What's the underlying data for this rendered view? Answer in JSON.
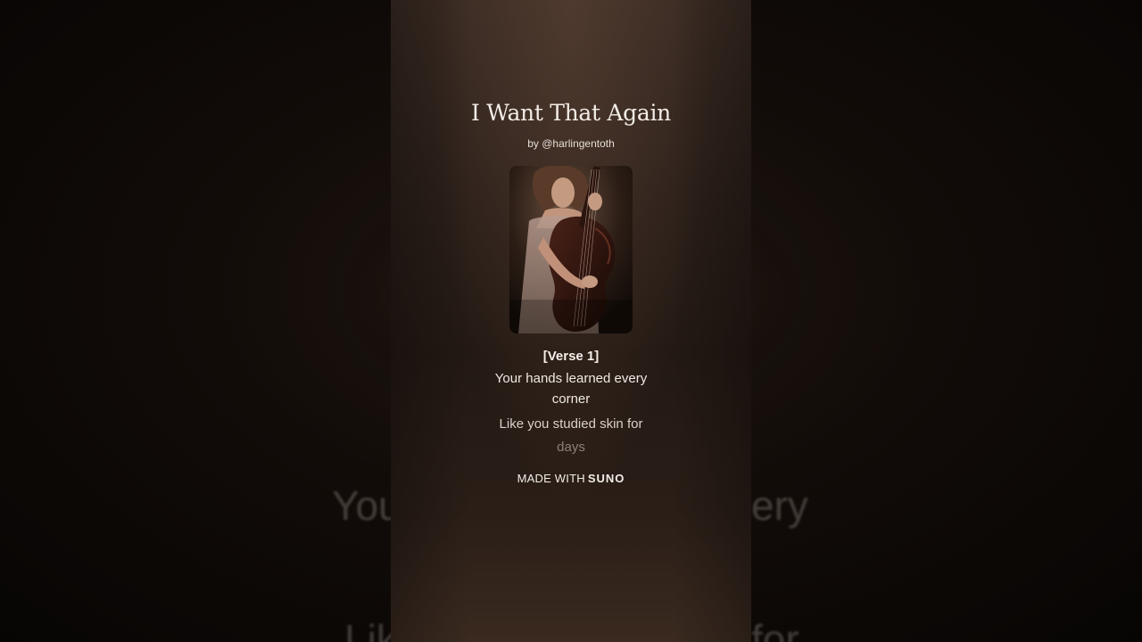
{
  "song": {
    "title": "I Want That Again",
    "artist": "by @harlingentoth"
  },
  "lyrics": {
    "section": "[Verse 1]",
    "line1": "Your hands learned every corner",
    "line2_part1": "Like you studied skin for",
    "line2_part2": "days"
  },
  "backdrop": {
    "left_1": "You",
    "right_1": "ery",
    "left_2": "Lik",
    "right_2": "for"
  },
  "branding": {
    "made_with": "MADE WITH",
    "brand_name": "SUNO"
  },
  "cover_art": {
    "icon": "cellist-portrait-image"
  },
  "colors": {
    "card_top": "#3a2b23",
    "card_bottom": "#231913",
    "text_primary": "#f3ece6",
    "text_dim": "#8d8179"
  }
}
